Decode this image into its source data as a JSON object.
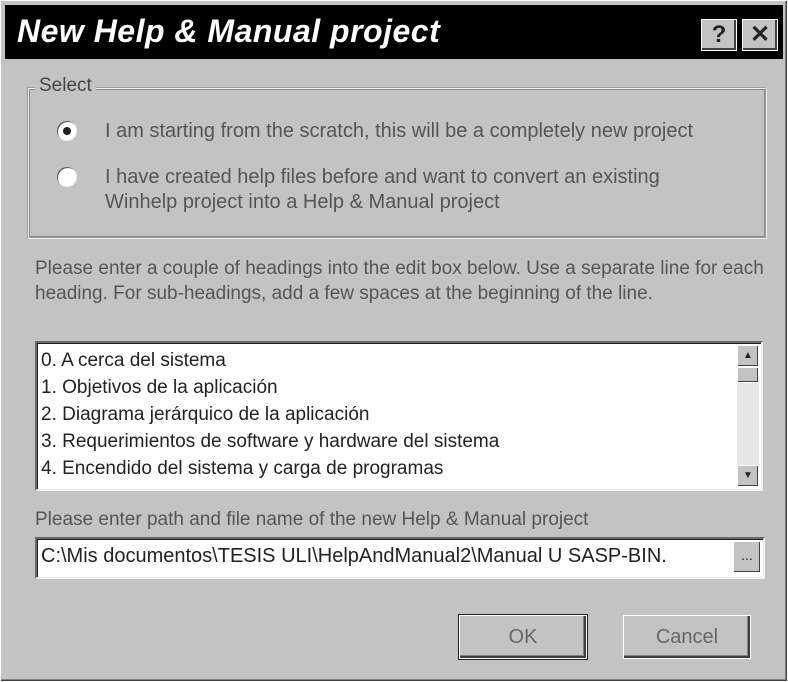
{
  "window": {
    "title": "New Help & Manual project",
    "help_button": "?",
    "close_button": "✕"
  },
  "select_group": {
    "label": "Select",
    "options": [
      {
        "label": "I am starting from the scratch, this will be a completely new project",
        "checked": true
      },
      {
        "label": "I have created help files before and want to convert an existing Winhelp project into a Help & Manual project",
        "checked": false
      }
    ]
  },
  "instructions": "Please enter a couple of headings into the edit box below. Use a separate line for each heading. For sub-headings, add a few spaces at the beginning of the line.",
  "headings": {
    "lines": [
      "0. A cerca del sistema",
      "1. Objetivos de la aplicación",
      "2. Diagrama jerárquico de la aplicación",
      "3. Requerimientos de software y hardware del sistema",
      "4. Encendido del sistema y carga de programas"
    ],
    "scroll_up": "▲",
    "scroll_down": "▼"
  },
  "path": {
    "label": "Please enter path and file name of the new Help & Manual project",
    "value": "C:\\Mis documentos\\TESIS ULI\\HelpAndManual2\\Manual U SASP-BIN.",
    "browse_label": "..."
  },
  "buttons": {
    "ok": "OK",
    "cancel": "Cancel"
  }
}
